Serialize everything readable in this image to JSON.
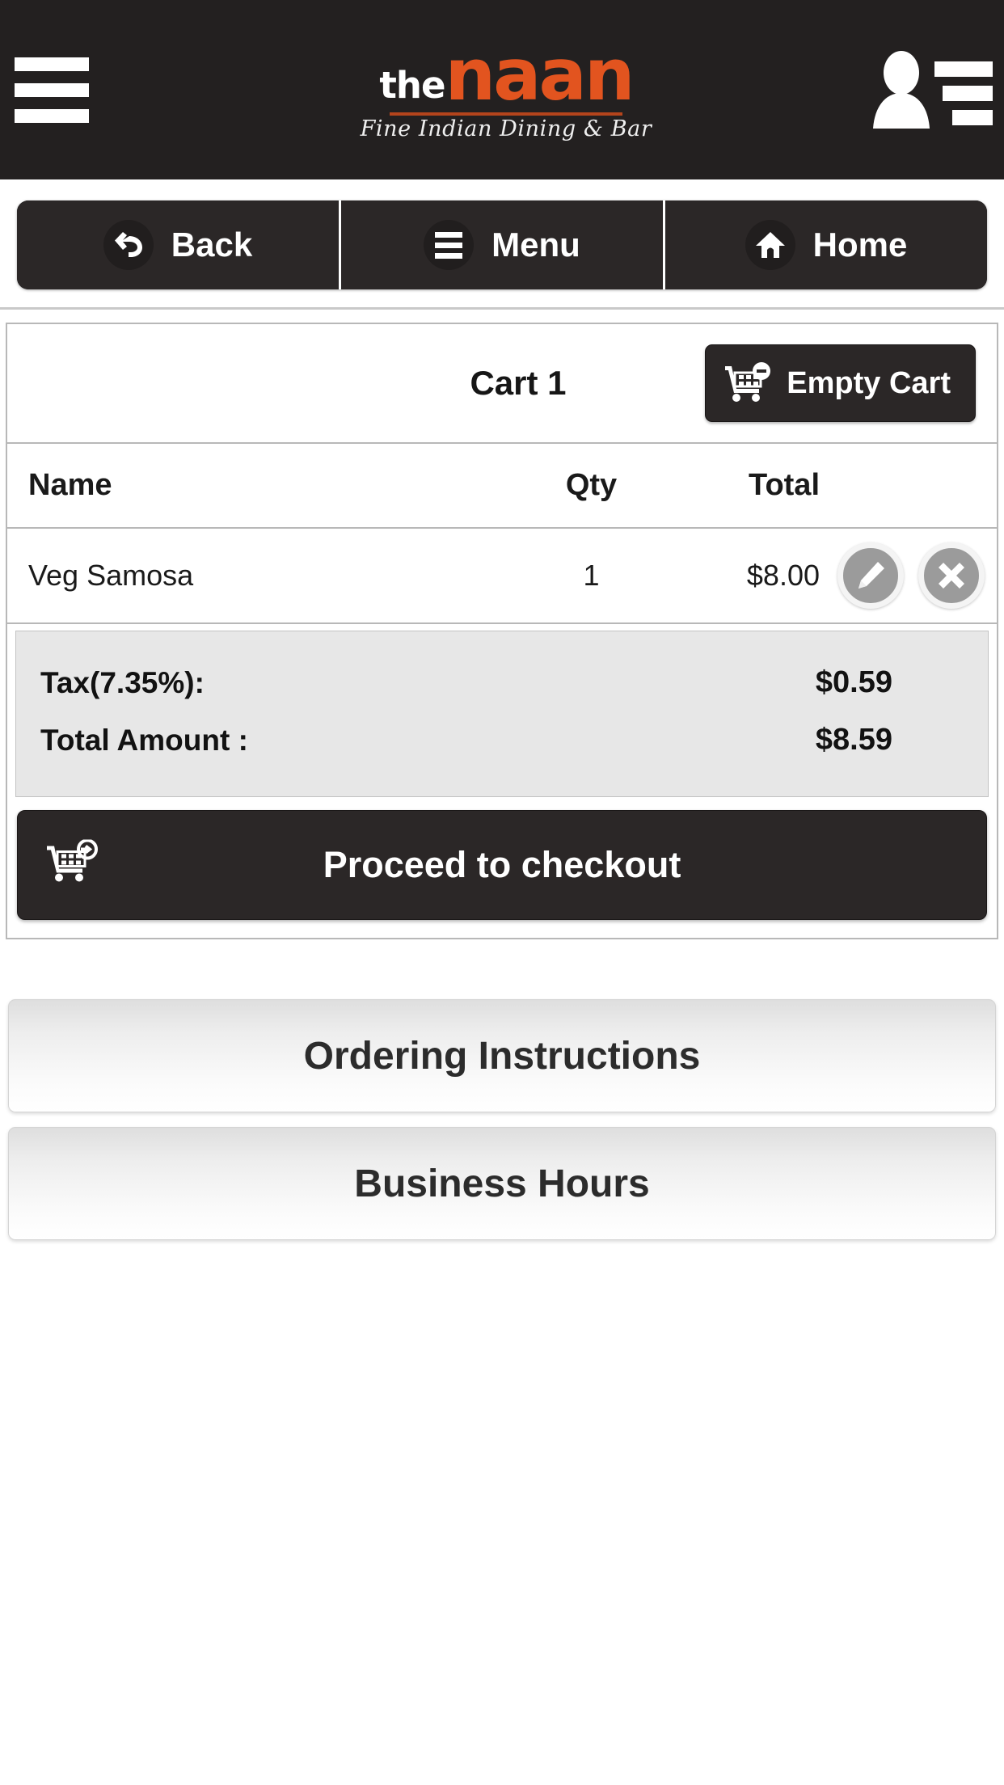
{
  "header": {
    "menu_icon": "hamburger-menu-icon",
    "logo": {
      "the": "the",
      "naan": "naan",
      "tagline": "Fine Indian Dining & Bar",
      "accent_color": "#e2541f"
    },
    "account_icon": "user-account-icon",
    "account_list_icon": "contact-list-icon",
    "background_color": "#232020"
  },
  "nav": {
    "buttons": [
      {
        "label": "Back",
        "icon": "undo-arrow-icon"
      },
      {
        "label": "Menu",
        "icon": "hamburger-menu-icon"
      },
      {
        "label": "Home",
        "icon": "home-icon"
      }
    ]
  },
  "cart": {
    "title": "Cart 1",
    "empty_cart": {
      "label": "Empty Cart",
      "icon": "cart-minus-icon"
    },
    "columns": {
      "name": "Name",
      "qty": "Qty",
      "total": "Total"
    },
    "items": [
      {
        "name": "Veg Samosa",
        "qty": "1",
        "total": "$8.00",
        "edit_icon": "pencil-edit-icon",
        "delete_icon": "close-x-icon"
      }
    ],
    "totals": [
      {
        "label": "Tax(7.35%):",
        "value": "$0.59"
      },
      {
        "label": "Total Amount :",
        "value": "$8.59"
      }
    ],
    "checkout": {
      "label": "Proceed to checkout",
      "icon": "cart-arrow-icon"
    }
  },
  "info_panels": [
    {
      "label": "Ordering Instructions"
    },
    {
      "label": "Business Hours"
    }
  ]
}
